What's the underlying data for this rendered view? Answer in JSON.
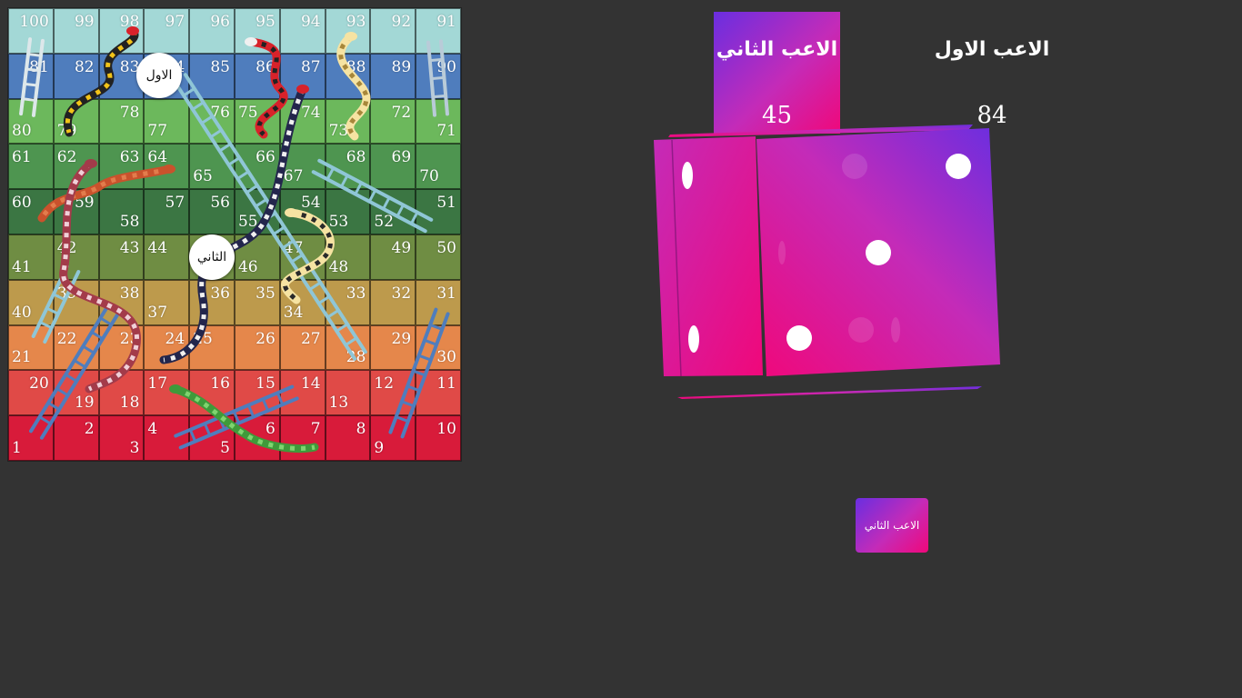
{
  "board": {
    "rows": [
      {
        "color": "#a3d8d6",
        "cells": [
          100,
          99,
          98,
          97,
          96,
          95,
          94,
          93,
          92,
          91
        ]
      },
      {
        "color": "#4f7dbd",
        "cells": [
          81,
          82,
          83,
          84,
          85,
          86,
          87,
          88,
          89,
          90
        ]
      },
      {
        "color": "#6cb85c",
        "cells": [
          80,
          79,
          78,
          77,
          76,
          75,
          74,
          73,
          72,
          71
        ]
      },
      {
        "color": "#4e9550",
        "cells": [
          61,
          62,
          63,
          64,
          65,
          66,
          67,
          68,
          69,
          70
        ]
      },
      {
        "color": "#3b7643",
        "cells": [
          60,
          59,
          58,
          57,
          56,
          55,
          54,
          53,
          52,
          51
        ]
      },
      {
        "color": "#6f8d43",
        "cells": [
          41,
          42,
          43,
          44,
          45,
          46,
          47,
          48,
          49,
          50
        ]
      },
      {
        "color": "#bd9a4c",
        "cells": [
          40,
          39,
          38,
          37,
          36,
          35,
          34,
          33,
          32,
          31
        ]
      },
      {
        "color": "#e5874b",
        "cells": [
          21,
          22,
          23,
          24,
          25,
          26,
          27,
          28,
          29,
          30
        ]
      },
      {
        "color": "#e04a47",
        "cells": [
          20,
          19,
          18,
          17,
          16,
          15,
          14,
          13,
          12,
          11
        ]
      },
      {
        "color": "#d81b3a",
        "cells": [
          1,
          2,
          3,
          4,
          5,
          6,
          7,
          8,
          9,
          10
        ]
      }
    ],
    "label_positions": [
      [
        "tr",
        "tr",
        "tr",
        "tr",
        "tr",
        "tr",
        "tr",
        "tr",
        "tr",
        "tr"
      ],
      [
        "tr",
        "tr",
        "tr",
        "tr",
        "tr",
        "tr",
        "tr",
        "tr",
        "tr",
        "tr"
      ],
      [
        "bl",
        "bl",
        "tr",
        "bl",
        "tr",
        "tl",
        "tr",
        "bl",
        "tr",
        "br"
      ],
      [
        "tl",
        "tl",
        "tr",
        "tl",
        "bl",
        "tr",
        "bl",
        "tr",
        "tr",
        "bl"
      ],
      [
        "tl",
        "tr",
        "br",
        "tr",
        "tr",
        "bl",
        "tr",
        "bl",
        "bl",
        "tr"
      ],
      [
        "bl",
        "tl",
        "tr",
        "tl",
        "tl",
        "bl",
        "tl",
        "bl",
        "tr",
        "tr"
      ],
      [
        "bl",
        "tl",
        "tr",
        "bl",
        "tr",
        "tr",
        "bl",
        "tr",
        "tr",
        "tr"
      ],
      [
        "bl",
        "tl",
        "tr",
        "tr",
        "tl",
        "tr",
        "tr",
        "br",
        "tr",
        "br"
      ],
      [
        "tr",
        "br",
        "br",
        "tl",
        "tr",
        "tr",
        "tr",
        "bl",
        "tl",
        "tr"
      ],
      [
        "bl",
        "tr",
        "br",
        "tl",
        "br",
        "tr",
        "tr",
        "tr",
        "bl",
        "tr"
      ]
    ],
    "snakes": [
      {
        "name": "snake-98-79",
        "colors": [
          "#222222",
          "#f2c318",
          "#d8222a"
        ]
      },
      {
        "name": "snake-95-75",
        "colors": [
          "#d8222a",
          "#222222",
          "#f0f0f0"
        ]
      },
      {
        "name": "snake-93-73",
        "colors": [
          "#f6e3a2",
          "#a7873a",
          "#f6e3a2"
        ]
      },
      {
        "name": "snake-88-36",
        "colors": [
          "#23264c",
          "#f0f0f0",
          "#d8222a"
        ]
      },
      {
        "name": "snake-64-60",
        "colors": [
          "#c9522c",
          "#e27c4c",
          "#c9522c"
        ]
      },
      {
        "name": "snake-62-19",
        "colors": [
          "#a33b4a",
          "#f0d0d8",
          "#a33b4a"
        ]
      },
      {
        "name": "snake-53-33",
        "colors": [
          "#f6e3a2",
          "#2a2a2a",
          "#f6e3a2"
        ]
      },
      {
        "name": "snake-16-7",
        "colors": [
          "#3f9a3a",
          "#7fd46f",
          "#3f9a3a"
        ]
      }
    ],
    "ladders": [
      {
        "name": "ladder-80-100",
        "color": "#dde7ea"
      },
      {
        "name": "ladder-71-91",
        "color": "#b9cbd8"
      },
      {
        "name": "ladder-28-84",
        "color": "#8fc6d6"
      },
      {
        "name": "ladder-52-68",
        "color": "#8fc6d6"
      },
      {
        "name": "ladder-21-42",
        "color": "#8fc6d6"
      },
      {
        "name": "ladder-1-39",
        "color": "#4f7dbd"
      },
      {
        "name": "ladder-5-16",
        "color": "#4f7dbd"
      },
      {
        "name": "ladder-9-31",
        "color": "#4f7dbd"
      }
    ]
  },
  "tokens": {
    "player1": {
      "label": "الاول",
      "square": 84
    },
    "player2": {
      "label": "الثاني",
      "square": 45
    }
  },
  "players": {
    "player1": {
      "title": "الاعب الاول",
      "score": "84"
    },
    "player2": {
      "title": "الاعب الثاني",
      "score": "45"
    }
  },
  "dice": {
    "value": 3,
    "colors": {
      "from": "#6a2ee0",
      "mid": "#c42bb8",
      "to": "#f0087a",
      "pip": "#ffffff"
    }
  },
  "roll_button": {
    "label": "الاعب الثاني"
  }
}
